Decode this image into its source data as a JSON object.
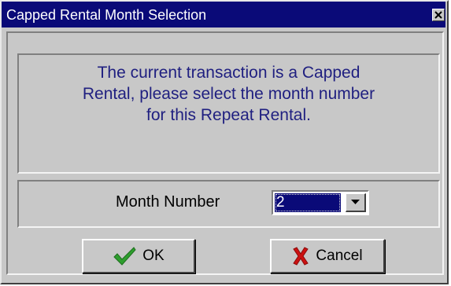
{
  "window": {
    "title": "Capped Rental Month Selection",
    "close_label": "×"
  },
  "message": {
    "text": "The current transaction is a Capped\nRental, please select the month number\nfor this Repeat Rental."
  },
  "month": {
    "label": "Month Number",
    "selected": "2"
  },
  "buttons": {
    "ok_label": "OK",
    "cancel_label": "Cancel"
  },
  "colors": {
    "titlebar": "#0a0a78",
    "face": "#c8c8c8",
    "message_text": "#1f1f80",
    "ok_icon": "#2e9e2e",
    "cancel_icon": "#cc1111"
  },
  "icons": {
    "close": "close-icon",
    "dropdown": "chevron-down-icon",
    "ok": "checkmark-icon",
    "cancel": "x-icon"
  }
}
